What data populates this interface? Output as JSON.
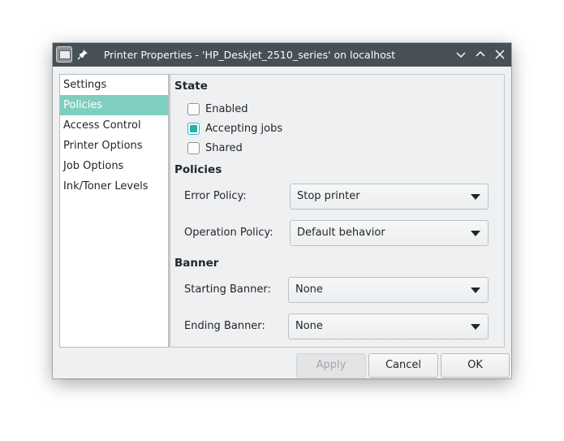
{
  "window": {
    "title": "Printer Properties - 'HP_Deskjet_2510_series' on localhost",
    "icons": [
      "printer-app-icon",
      "pin-icon",
      "minimize-icon",
      "maximize-icon",
      "close-icon"
    ]
  },
  "sidebar": {
    "items": [
      {
        "label": "Settings",
        "selected": false
      },
      {
        "label": "Policies",
        "selected": true
      },
      {
        "label": "Access Control",
        "selected": false
      },
      {
        "label": "Printer Options",
        "selected": false
      },
      {
        "label": "Job Options",
        "selected": false
      },
      {
        "label": "Ink/Toner Levels",
        "selected": false
      }
    ],
    "selected_color": "#7fcfc0"
  },
  "state": {
    "title": "State",
    "enabled": {
      "label": "Enabled",
      "checked": false
    },
    "accepting_jobs": {
      "label": "Accepting jobs",
      "checked": true
    },
    "shared": {
      "label": "Shared",
      "checked": false
    }
  },
  "policies": {
    "title": "Policies",
    "error_policy": {
      "label": "Error Policy:",
      "value": "Stop printer"
    },
    "operation_policy": {
      "label": "Operation Policy:",
      "value": "Default behavior"
    }
  },
  "banner": {
    "title": "Banner",
    "starting": {
      "label": "Starting Banner:",
      "value": "None"
    },
    "ending": {
      "label": "Ending Banner:",
      "value": "None"
    }
  },
  "buttons": {
    "apply": "Apply",
    "cancel": "Cancel",
    "ok": "OK"
  },
  "colors": {
    "titlebar": "#475057",
    "accent_check": "#20b69a"
  }
}
